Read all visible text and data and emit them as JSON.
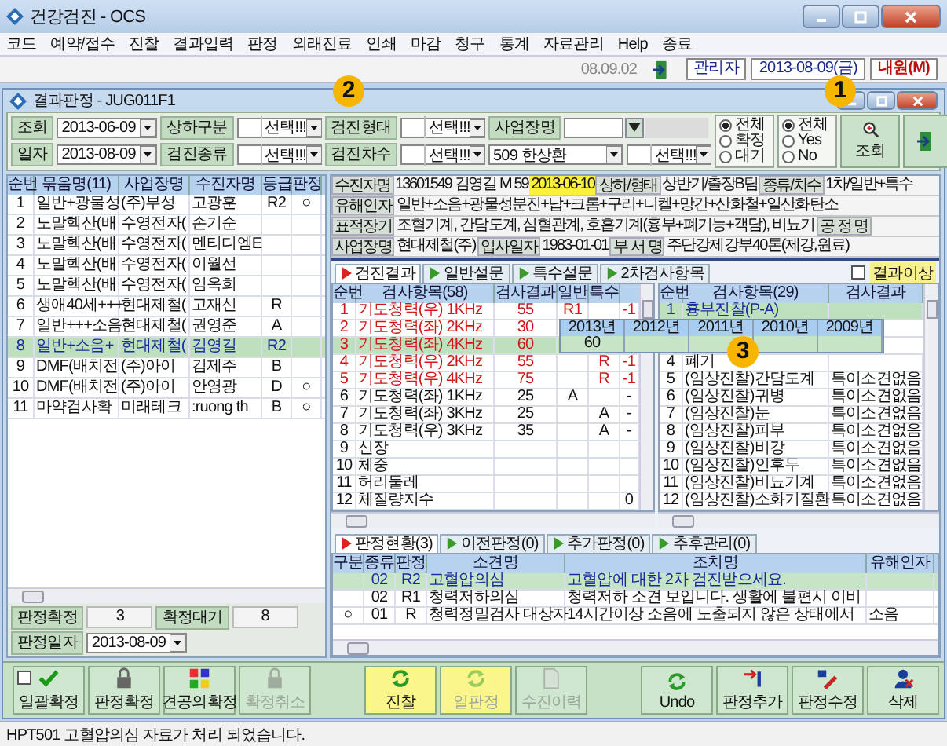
{
  "window": {
    "title": "건강검진 - OCS"
  },
  "menu": [
    "코드",
    "예약/접수",
    "진찰",
    "결과입력",
    "판정",
    "외래진료",
    "인쇄",
    "마감",
    "청구",
    "통계",
    "자료관리",
    "Help",
    "종료"
  ],
  "toolbar": {
    "version": "08.09.02",
    "user": "관리자",
    "date": "2013-08-09(금)",
    "visit": "내원(M)"
  },
  "child_window": {
    "title": "결과판정 - JUG011F1"
  },
  "filters": [
    [
      {
        "kind": "label",
        "text": "조회"
      },
      {
        "kind": "date",
        "value": "2013-06-09"
      },
      {
        "kind": "label",
        "text": "상하구분"
      },
      {
        "kind": "combo",
        "value": "선택!!!"
      },
      {
        "kind": "label",
        "text": "검진형태"
      },
      {
        "kind": "combo",
        "value": "선택!!!"
      },
      {
        "kind": "label",
        "text": "사업장명"
      },
      {
        "kind": "search"
      }
    ],
    [
      {
        "kind": "label",
        "text": "일자"
      },
      {
        "kind": "date",
        "value": "2013-08-09"
      },
      {
        "kind": "label",
        "text": "검진종류"
      },
      {
        "kind": "combo",
        "value": "선택!!!"
      },
      {
        "kind": "label",
        "text": "검진차수"
      },
      {
        "kind": "combo",
        "value": "선택!!!"
      },
      {
        "kind": "wide",
        "value": "509 한상환"
      },
      {
        "kind": "combo",
        "value": "선택!!!"
      }
    ]
  ],
  "status_filter": [
    {
      "label": "전체",
      "selected": true
    },
    {
      "label": "확정",
      "selected": false
    },
    {
      "label": "대기",
      "selected": false
    }
  ],
  "yes_no_filter": [
    {
      "label": "전체",
      "selected": true
    },
    {
      "label": "Yes",
      "selected": false
    },
    {
      "label": "No",
      "selected": false
    }
  ],
  "search_button": "조회",
  "groups": {
    "columns": [
      "순번",
      "묶음명(11)",
      "사업장명",
      "수진자명",
      "등급",
      "판정"
    ],
    "rows": [
      {
        "cells": [
          "1",
          "일반+광물성",
          "(주)부성",
          "고광훈",
          "R2",
          "○"
        ],
        "selected": false
      },
      {
        "cells": [
          "2",
          "노말헥산(배",
          "수영전자(",
          "손기순",
          "",
          ""
        ],
        "selected": false
      },
      {
        "cells": [
          "3",
          "노말헥산(배",
          "수영전자(",
          "멘티디엠E",
          "",
          ""
        ],
        "selected": false
      },
      {
        "cells": [
          "4",
          "노말헥산(배",
          "수영전자(",
          "이월선",
          "",
          ""
        ],
        "selected": false
      },
      {
        "cells": [
          "5",
          "노말헥산(배",
          "수영전자(",
          "임옥희",
          "",
          ""
        ],
        "selected": false
      },
      {
        "cells": [
          "6",
          "생애40세+++",
          "현대제철(",
          "고재신",
          "R",
          ""
        ],
        "selected": false
      },
      {
        "cells": [
          "7",
          "일반+++소음",
          "현대제철(",
          "권영준",
          "A",
          ""
        ],
        "selected": false
      },
      {
        "cells": [
          "8",
          "일반+소음+",
          "현대제철(",
          "김영길",
          "R2",
          ""
        ],
        "selected": true
      },
      {
        "cells": [
          "9",
          "DMF(배치전",
          "(주)아이",
          "김제주",
          "B",
          ""
        ],
        "selected": false
      },
      {
        "cells": [
          "10",
          "DMF(배치전",
          "(주)아이",
          "안영광",
          "D",
          "○"
        ],
        "selected": false
      },
      {
        "cells": [
          "11",
          "마약검사확",
          "미래테크",
          ":ruong th",
          "B",
          "○"
        ],
        "selected": false
      }
    ]
  },
  "group_summary": {
    "confirmed_label": "판정확정",
    "confirmed": "3",
    "pending_label": "확정대기",
    "pending": "8",
    "date_label": "판정일자",
    "date": "2013-08-09"
  },
  "patient": [
    [
      {
        "kind": "label",
        "text": "수진자명"
      },
      {
        "kind": "value",
        "text": "13601549"
      },
      {
        "kind": "value",
        "text": "김영길"
      },
      {
        "kind": "value",
        "text": "M"
      },
      {
        "kind": "value",
        "text": "59"
      },
      {
        "kind": "marked",
        "text": "2013-06-10"
      },
      {
        "kind": "label",
        "text": "상하/형태"
      },
      {
        "kind": "value",
        "text": "상반기/출장B팀"
      },
      {
        "kind": "label",
        "text": "종류/차수"
      },
      {
        "kind": "value",
        "text": "1차/일반+특수"
      }
    ],
    [
      {
        "kind": "label",
        "text": "유해인자"
      },
      {
        "kind": "value",
        "text": "일반+소음+광물성분진+납+크롬+구리+니켈+망간+산화철+일산화탄소"
      }
    ],
    [
      {
        "kind": "label",
        "text": "표적장기"
      },
      {
        "kind": "value",
        "text": "조혈기계, 간담도계, 심혈관계, 호흡기계(흉부+폐기능+객담), 비뇨기"
      },
      {
        "kind": "label",
        "text": "공 정 명"
      },
      {
        "kind": "empty"
      }
    ],
    [
      {
        "kind": "label",
        "text": "사업장명"
      },
      {
        "kind": "value",
        "text": "현대제철(주)"
      },
      {
        "kind": "label",
        "text": "입사일자"
      },
      {
        "kind": "value",
        "text": "1983-01-01"
      },
      {
        "kind": "label",
        "text": "부 서 명"
      },
      {
        "kind": "value",
        "text": "주단강제강부40톤(제강,원료)"
      }
    ]
  ],
  "result_tabs": [
    {
      "label": "검진결과",
      "selected": true
    },
    {
      "label": "일반설문",
      "selected": false
    },
    {
      "label": "특수설문",
      "selected": false
    },
    {
      "label": "2차검사항목",
      "selected": false
    }
  ],
  "abnormal_filter": {
    "label": "결과이상",
    "checked": false
  },
  "results": {
    "columns": [
      "순번",
      "검사항목(58)",
      "검사결과",
      "일반",
      "특수"
    ],
    "rows": [
      {
        "cells": [
          "1",
          "기도청력(우) 1KHz",
          "55",
          "R1",
          "",
          "-1"
        ],
        "abnormal": true,
        "selected": false
      },
      {
        "cells": [
          "2",
          "기도청력(좌) 2KHz",
          "30"
        ],
        "abnormal": true,
        "selected": false
      },
      {
        "cells": [
          "3",
          "기도청력(좌) 4KHz",
          "60"
        ],
        "abnormal": true,
        "selected": true
      },
      {
        "cells": [
          "4",
          "기도청력(우) 2KHz",
          "55",
          "",
          "R",
          "-1"
        ],
        "abnormal": true,
        "selected": false
      },
      {
        "cells": [
          "5",
          "기도청력(우) 4KHz",
          "75",
          "",
          "R",
          "-1"
        ],
        "abnormal": true,
        "selected": false
      },
      {
        "cells": [
          "6",
          "기도청력(좌) 1KHz",
          "25",
          "A",
          "",
          "-"
        ],
        "abnormal": false,
        "selected": false
      },
      {
        "cells": [
          "7",
          "기도청력(좌) 3KHz",
          "25",
          "",
          "A",
          "-"
        ],
        "abnormal": false,
        "selected": false
      },
      {
        "cells": [
          "8",
          "기도청력(우) 3KHz",
          "35",
          "",
          "A",
          "-"
        ],
        "abnormal": false,
        "selected": false
      },
      {
        "cells": [
          "9",
          "신장",
          "",
          "",
          "",
          ""
        ],
        "abnormal": false,
        "selected": false
      },
      {
        "cells": [
          "10",
          "체중",
          "",
          "",
          "",
          ""
        ],
        "abnormal": false,
        "selected": false
      },
      {
        "cells": [
          "11",
          "허리둘레",
          "",
          "",
          "",
          ""
        ],
        "abnormal": false,
        "selected": false
      },
      {
        "cells": [
          "12",
          "체질량지수",
          "",
          "",
          "",
          "0"
        ],
        "abnormal": false,
        "selected": false
      }
    ]
  },
  "history_popup": {
    "columns": [
      "2013년",
      "2012년",
      "2011년",
      "2010년",
      "2009년"
    ],
    "values": [
      "60"
    ]
  },
  "exams": {
    "columns": [
      "순번",
      "검사항목(29)",
      "검사결과"
    ],
    "rows": [
      {
        "cells": [
          "1",
          "흉부진찰(P-A)",
          ""
        ],
        "selected": true
      },
      {
        "cells": [],
        "selected": false
      },
      {
        "cells": [],
        "selected": false
      },
      {
        "cells": [
          "4",
          "폐기",
          ""
        ],
        "selected": false
      },
      {
        "cells": [
          "5",
          "(임상진찰)간담도계",
          "특이소견없음"
        ],
        "selected": false
      },
      {
        "cells": [
          "6",
          "(임상진찰)귀병",
          "특이소견없음"
        ],
        "selected": false
      },
      {
        "cells": [
          "7",
          "(임상진찰)눈",
          "특이소견없음"
        ],
        "selected": false
      },
      {
        "cells": [
          "8",
          "(임상진찰)피부",
          "특이소견없음"
        ],
        "selected": false
      },
      {
        "cells": [
          "9",
          "(임상진찰)비강",
          "특이소견없음"
        ],
        "selected": false
      },
      {
        "cells": [
          "10",
          "(임상진찰)인후두",
          "특이소견없음"
        ],
        "selected": false
      },
      {
        "cells": [
          "11",
          "(임상진찰)비뇨기계",
          "특이소견없음"
        ],
        "selected": false
      },
      {
        "cells": [
          "12",
          "(임상진찰)소화기질환",
          "특이소견없음"
        ],
        "selected": false
      }
    ]
  },
  "judgment_tabs": [
    {
      "label": "판정현황(3)",
      "selected": true
    },
    {
      "label": "이전판정(0)",
      "selected": false
    },
    {
      "label": "추가판정(0)",
      "selected": false
    },
    {
      "label": "추후관리(0)",
      "selected": false
    }
  ],
  "judgments": {
    "columns": [
      "구분",
      "종류",
      "판정",
      "소견명",
      "조치명",
      "유해인자"
    ],
    "rows": [
      {
        "cells": [
          "",
          "02",
          "R2",
          "고혈압의심",
          "고혈압에 대한 2차 검진받으세요.",
          ""
        ],
        "selected": true
      },
      {
        "cells": [
          "",
          "02",
          "R1",
          "청력저하의심",
          "청력저하 소견 보입니다. 생활에 불편시 이비",
          ""
        ],
        "selected": false
      },
      {
        "cells": [
          "○",
          "01",
          "R",
          "청력정밀검사 대상자",
          "14시간이상 소음에 노출되지 않은 상태에서",
          "소음"
        ],
        "selected": false
      }
    ]
  },
  "actions": [
    [
      {
        "label": "일괄확정",
        "kind": "checkbox",
        "checked": false,
        "disabled": false,
        "highlight": false
      },
      {
        "label": "판정확정",
        "kind": "button",
        "disabled": false,
        "highlight": false
      },
      {
        "label": "견공의확정",
        "kind": "button",
        "disabled": false,
        "highlight": false
      },
      {
        "label": "확정취소",
        "kind": "button",
        "disabled": true,
        "highlight": false
      }
    ],
    [
      {
        "label": "진찰",
        "kind": "button",
        "disabled": false,
        "highlight": true
      },
      {
        "label": "일판정",
        "kind": "button",
        "disabled": true,
        "highlight": true
      },
      {
        "label": "수진이력",
        "kind": "button",
        "disabled": true,
        "highlight": false
      }
    ],
    [
      {
        "label": "Undo",
        "kind": "button",
        "disabled": false,
        "highlight": false
      },
      {
        "label": "판정추가",
        "kind": "button",
        "disabled": false,
        "highlight": false
      },
      {
        "label": "판정수정",
        "kind": "button",
        "disabled": false,
        "highlight": false
      },
      {
        "label": "삭제",
        "kind": "button",
        "disabled": false,
        "highlight": false
      }
    ]
  ],
  "status_bar": "HPT501 고혈압의심 자료가 처리 되었습니다.",
  "callouts": [
    "1",
    "2",
    "3"
  ]
}
